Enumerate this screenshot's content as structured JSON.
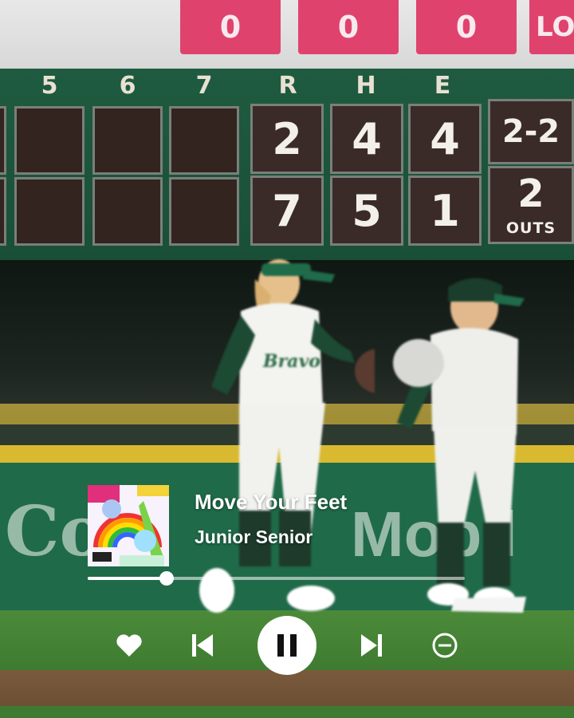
{
  "scoreboard": {
    "top_values": [
      "0",
      "0",
      "0",
      "LO"
    ],
    "inning_headers": [
      "5",
      "6",
      "7"
    ],
    "rhe_headers": [
      "R",
      "H",
      "E"
    ],
    "away": {
      "r": "2",
      "h": "4",
      "e": "4"
    },
    "home": {
      "r": "7",
      "h": "5",
      "e": "1"
    },
    "count": "2-2",
    "outs_value": "2",
    "outs_label": "OUTS"
  },
  "wall_ads": {
    "left": "Co",
    "right": "Mobil"
  },
  "player": {
    "track_title": "Move Your Feet",
    "artist": "Junior Senior",
    "progress": 0.21,
    "controls": [
      "heart-icon",
      "previous-icon",
      "pause-icon",
      "next-icon",
      "minus-circle-icon"
    ]
  }
}
